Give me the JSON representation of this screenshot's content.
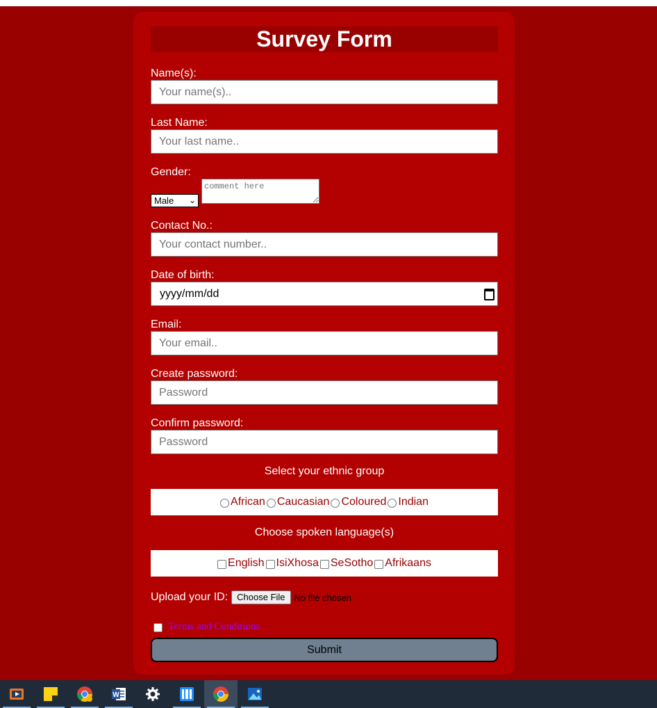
{
  "form": {
    "title": "Survey Form",
    "fields": {
      "names_label": "Name(s):",
      "names_placeholder": "Your name(s)..",
      "last_name_label": "Last Name:",
      "last_name_placeholder": "Your last name..",
      "gender_label": "Gender:",
      "gender_selected": "Male",
      "comment_placeholder": "comment here",
      "contact_label": "Contact No.:",
      "contact_placeholder": "Your contact number..",
      "dob_label": "Date of birth:",
      "dob_placeholder": "yyyy/mm/dd",
      "email_label": "Email:",
      "email_placeholder": "Your email..",
      "create_password_label": "Create password:",
      "create_password_placeholder": "Password",
      "confirm_password_label": "Confirm password:",
      "confirm_password_placeholder": "Password"
    },
    "ethnic": {
      "heading": "Select your ethnic group",
      "options": [
        "African",
        "Caucasian",
        "Coloured",
        "Indian"
      ]
    },
    "languages": {
      "heading": "Choose spoken language(s)",
      "options": [
        "English",
        "IsiXhosa",
        "SeSotho",
        "Afrikaans"
      ]
    },
    "upload": {
      "label": "Upload your ID:",
      "button": "Choose File",
      "status": "No file chosen"
    },
    "terms_label": "Terms and Conditions",
    "submit_label": "Submit"
  },
  "taskbar": {
    "items": [
      "media-player-icon",
      "sticky-notes-icon",
      "chrome-canary-icon",
      "word-icon",
      "settings-icon",
      "remote-app-icon",
      "chrome-icon",
      "photos-icon"
    ],
    "active_index": 6
  },
  "colors": {
    "page_bg": "#990000",
    "card_bg": "#b30000",
    "submit_bg": "#708090",
    "option_text": "#990000",
    "terms_link": "#9900ff"
  }
}
